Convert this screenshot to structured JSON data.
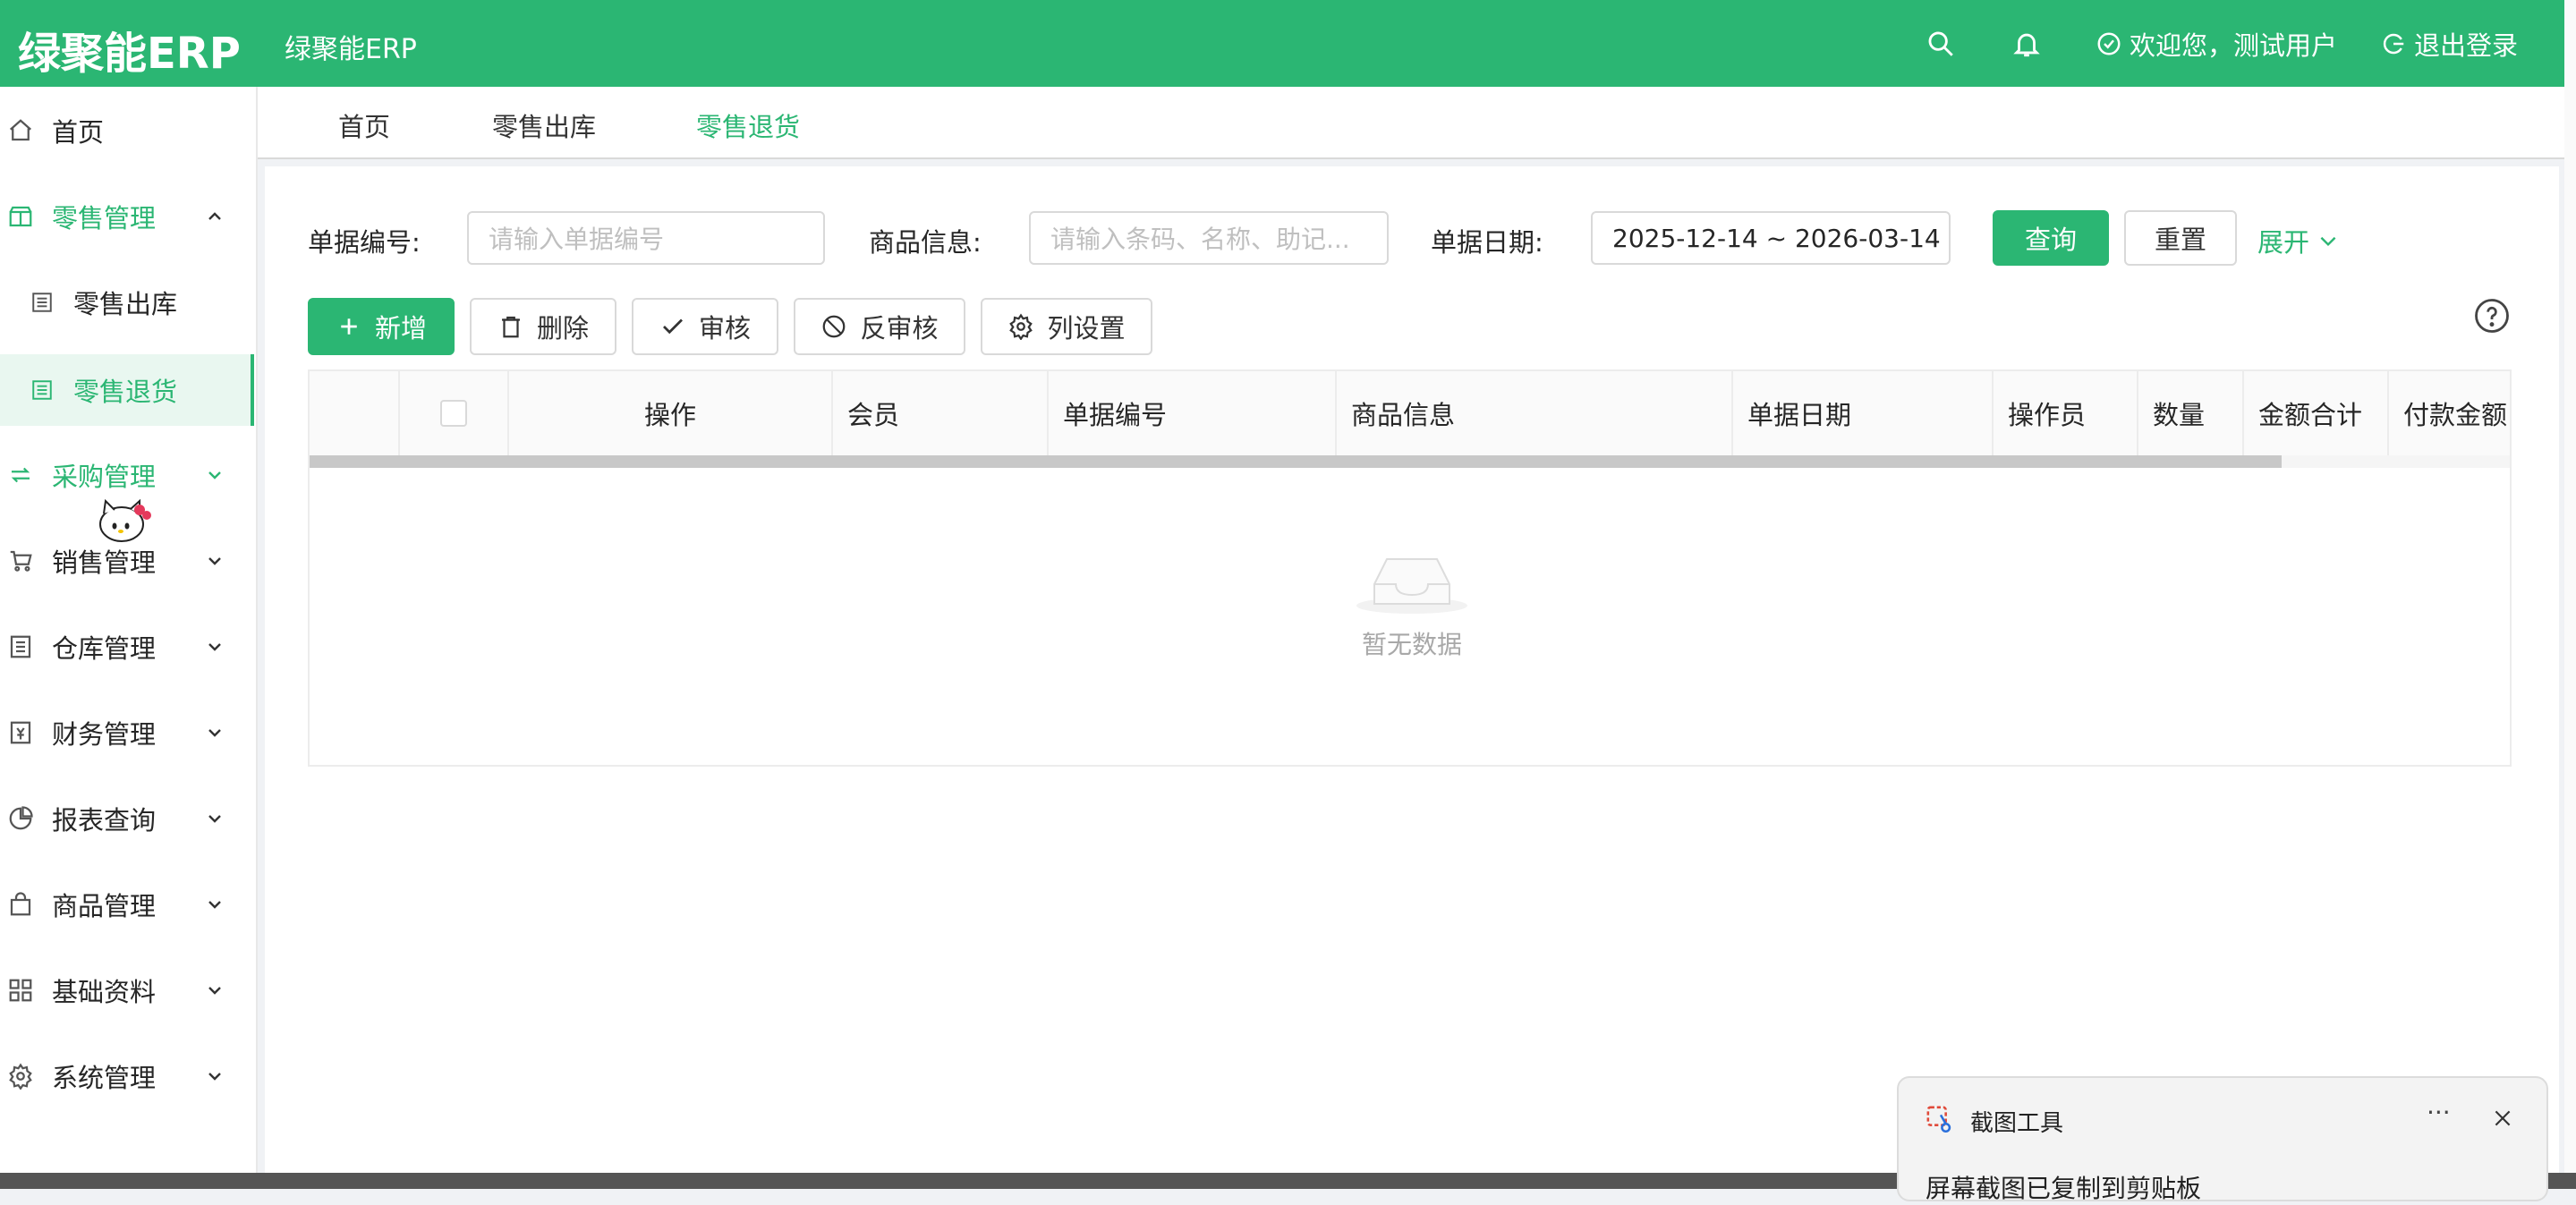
{
  "header": {
    "logo": "绿聚能ERP",
    "app_title": "绿聚能ERP",
    "welcome": "欢迎您，测试用户",
    "logout": "退出登录"
  },
  "sidebar": {
    "items": [
      {
        "label": "首页",
        "icon": "home-icon"
      },
      {
        "label": "零售管理",
        "icon": "shop-icon"
      },
      {
        "label": "零售出库",
        "icon": "list-icon"
      },
      {
        "label": "零售退货",
        "icon": "list-icon"
      },
      {
        "label": "采购管理",
        "icon": "swap-icon"
      },
      {
        "label": "销售管理",
        "icon": "cart-icon"
      },
      {
        "label": "仓库管理",
        "icon": "warehouse-icon"
      },
      {
        "label": "财务管理",
        "icon": "finance-icon"
      },
      {
        "label": "报表查询",
        "icon": "pie-chart-icon"
      },
      {
        "label": "商品管理",
        "icon": "bag-icon"
      },
      {
        "label": "基础资料",
        "icon": "grid-icon"
      },
      {
        "label": "系统管理",
        "icon": "gear-icon"
      }
    ]
  },
  "tabs": [
    {
      "label": "首页"
    },
    {
      "label": "零售出库"
    },
    {
      "label": "零售退货",
      "active": true
    }
  ],
  "filters": {
    "doc_no_label": "单据编号:",
    "doc_no_placeholder": "请输入单据编号",
    "product_label": "商品信息:",
    "product_placeholder": "请输入条码、名称、助记...",
    "date_label": "单据日期:",
    "date_value": "2025-12-14 ~ 2026-03-14",
    "query": "查询",
    "reset": "重置",
    "expand": "展开"
  },
  "toolbar": {
    "add": "新增",
    "delete": "删除",
    "audit": "审核",
    "unaudit": "反审核",
    "columns": "列设置"
  },
  "table": {
    "columns": [
      "操作",
      "会员",
      "单据编号",
      "商品信息",
      "单据日期",
      "操作员",
      "数量",
      "金额合计",
      "付款金额"
    ],
    "empty_text": "暂无数据"
  },
  "toast": {
    "title": "截图工具",
    "message": "屏幕截图已复制到剪贴板",
    "more": "···"
  },
  "colors": {
    "accent": "#2bb673",
    "header_bg": "#2bb673",
    "active_bg": "#e9f7f0"
  }
}
